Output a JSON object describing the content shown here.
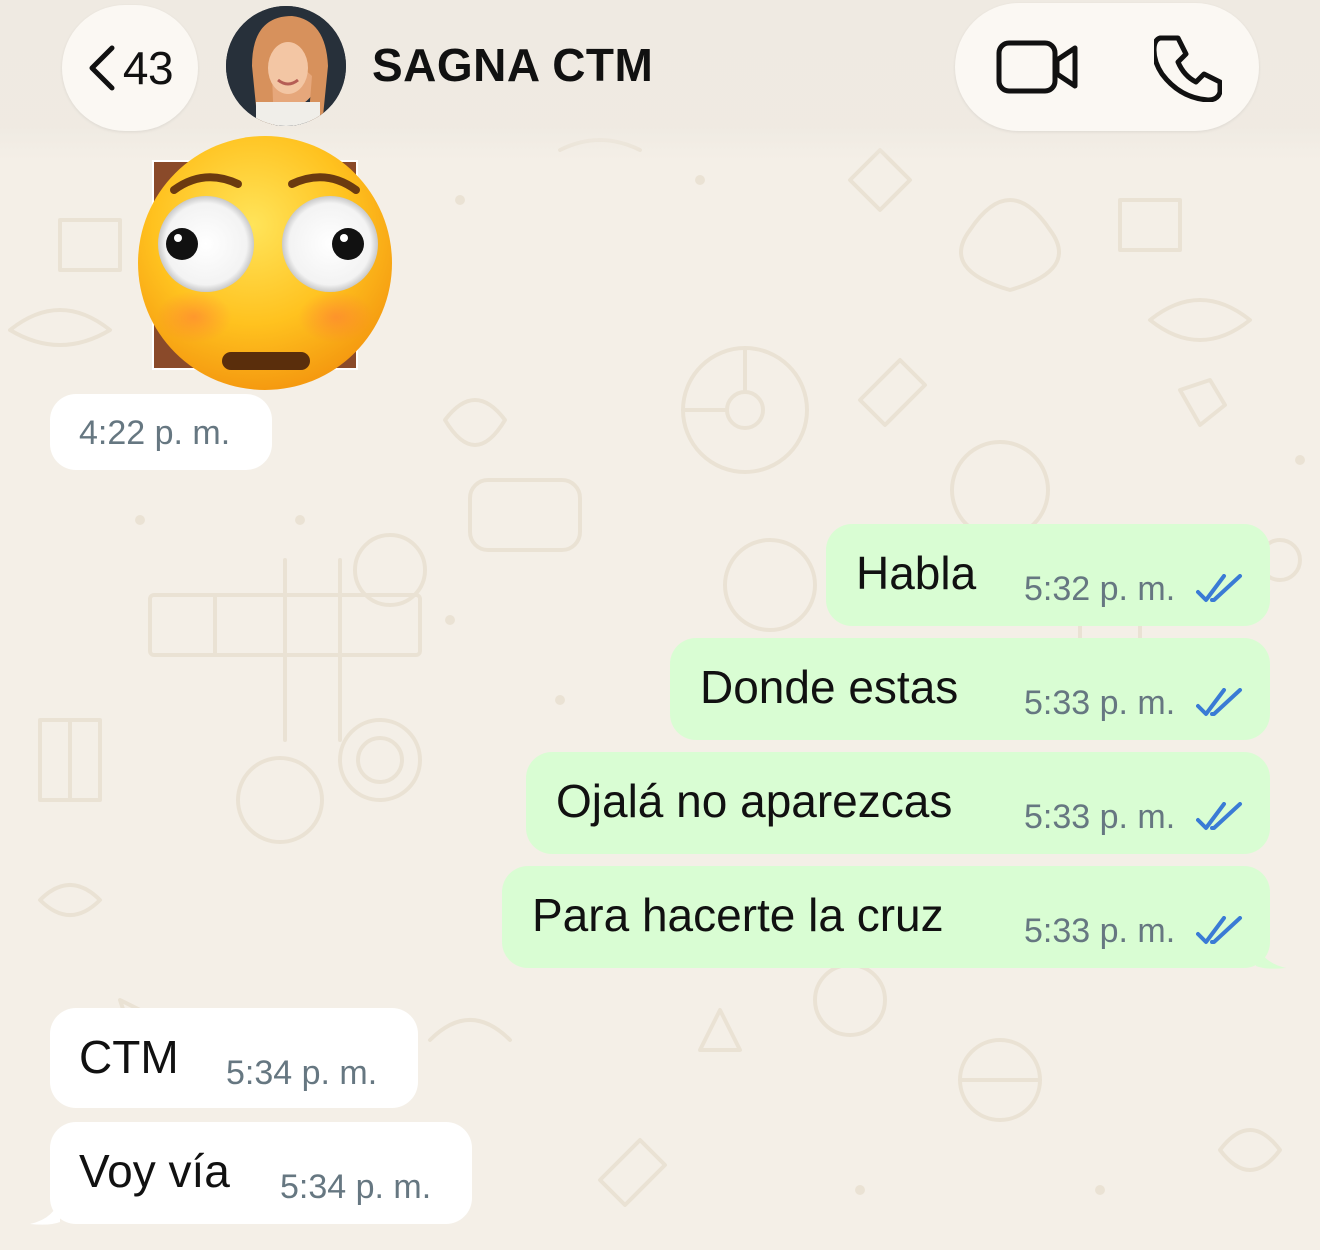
{
  "header": {
    "back_count": "43",
    "contact_name": "SAGNA CTM",
    "back_icon": "chevron-left-icon",
    "video_icon": "video-camera-icon",
    "call_icon": "phone-icon"
  },
  "sticker_message": {
    "sticker": "flushed-face-emoji",
    "time": "4:22 p. m."
  },
  "messages": [
    {
      "direction": "out",
      "text": "Habla",
      "time": "5:32 p. m.",
      "status": "read"
    },
    {
      "direction": "out",
      "text": "Donde estas",
      "time": "5:33 p. m.",
      "status": "read"
    },
    {
      "direction": "out",
      "text": "Ojalá no aparezcas",
      "time": "5:33 p. m.",
      "status": "read"
    },
    {
      "direction": "out",
      "text": "Para hacerte la cruz",
      "time": "5:33 p. m.",
      "status": "read"
    },
    {
      "direction": "in",
      "text": "CTM",
      "time": "5:34 p. m."
    },
    {
      "direction": "in",
      "text": "Voy vía",
      "time": "5:34 p. m."
    }
  ],
  "colors": {
    "background": "#f4efe7",
    "outgoing_bubble": "#d9fdd3",
    "incoming_bubble": "#ffffff",
    "read_ticks": "#3a7bd5",
    "time_text": "#667781"
  }
}
